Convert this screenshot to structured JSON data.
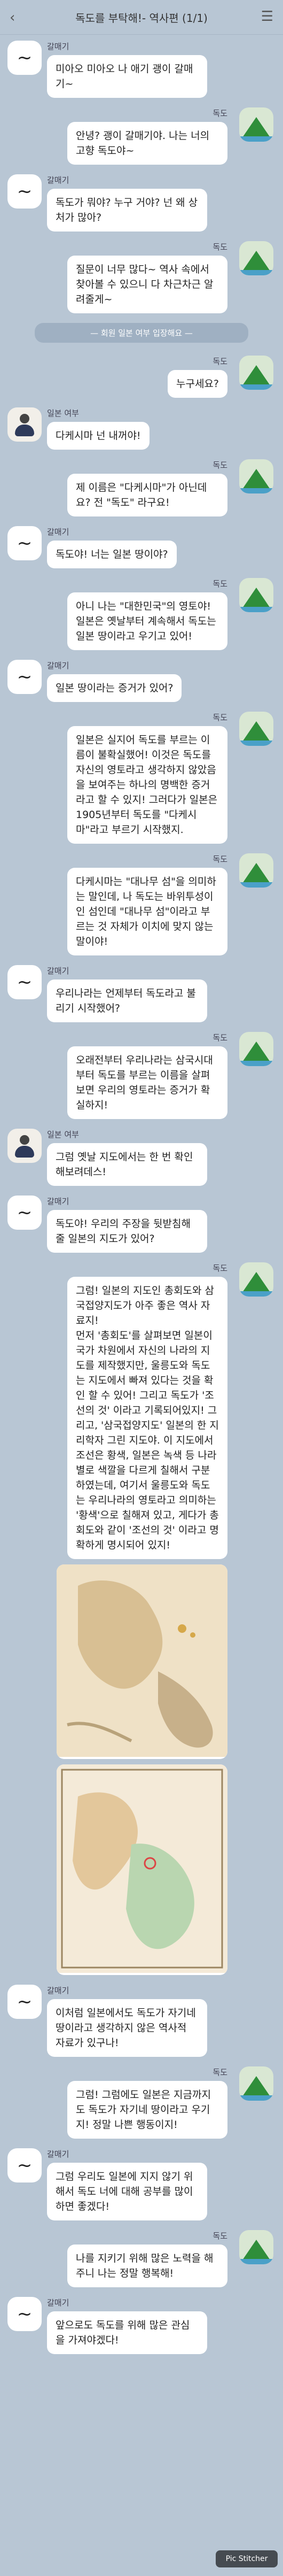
{
  "header": {
    "back_icon": "back-arrow-icon",
    "title": "독도를 부탁해!- 역사편 (1/1)",
    "menu_icon": "hamburger-menu-icon"
  },
  "system": {
    "joined": "— 회원 일본 여부 입장해요 —"
  },
  "messages": [
    {
      "side": "left",
      "sender": "갈매기",
      "text": "미아오 미아오 나 애기 괭이 갈매기~"
    },
    {
      "side": "right",
      "sender": "독도",
      "text": "안녕? 괭이 갈매기야. 나는 너의 고향 독도야~"
    },
    {
      "side": "left",
      "sender": "갈매기",
      "text": "독도가 뭐야? 누구 거야? 넌 왜 상처가 많아?"
    },
    {
      "side": "right",
      "sender": "독도",
      "text": "질문이 너무 많다~ 역사 속에서 찾아볼 수 있으니 다 차근차근 알려줄게~"
    },
    {
      "side": "right",
      "sender": "독도",
      "text": "누구세요?"
    },
    {
      "side": "left",
      "sender": "일본 여부",
      "text": "다케시마 넌 내꺼야!"
    },
    {
      "side": "right",
      "sender": "독도",
      "text": "제 이름은 \"다케시마\"가 아닌데요? 전 \"독도\" 라구요!"
    },
    {
      "side": "left",
      "sender": "갈매기",
      "text": "독도야! 너는 일본 땅이야?"
    },
    {
      "side": "right",
      "sender": "독도",
      "text": "아니 나는 \"대한민국\"의 영토야! 일본은 옛날부터 계속해서 독도는 일본 땅이라고 우기고 있어!"
    },
    {
      "side": "left",
      "sender": "갈매기",
      "text": "일본 땅이라는 증거가 있어?"
    },
    {
      "side": "right",
      "sender": "독도",
      "text": "일본은 실지어 독도를 부르는 이름이 불확실했어! 이것은 독도를 자신의 영토라고 생각하지 않았음을 보여주는 하나의 명백한 증거라고 할 수 있지! 그러다가 일본은 1905년부터 독도를 \"다케시마\"라고 부르기 시작했지."
    },
    {
      "side": "right",
      "sender": "독도",
      "text": "다케시마는 \"대나무 섬\"을 의미하는 말인데, 나 독도는 바위투성이인 섬인데 \"대나무 섬\"이라고 부르는 것 자체가 이치에 맞지 않는 말이야!"
    },
    {
      "side": "left",
      "sender": "갈매기",
      "text": "우리나라는 언제부터 독도라고 불리기 시작했어?"
    },
    {
      "side": "right",
      "sender": "독도",
      "text": "오래전부터 우리나라는 삼국시대부터 독도를 부르는 이름을 살펴보면 우리의 영토라는 증거가 확실하지!"
    },
    {
      "side": "left",
      "sender": "일본 여부",
      "text": "그럼 옛날 지도에서는 한 번 확인해보려데스!"
    },
    {
      "side": "left",
      "sender": "갈매기",
      "text": "독도야! 우리의 주장을 뒷받침해줄 일본의 지도가 있어?"
    },
    {
      "side": "right",
      "sender": "독도",
      "text": "그럼! 일본의 지도인 총회도와 삼국접양지도가 아주 좋은 역사 자료지!\n먼저 '총회도'를 살펴보면 일본이 국가 차원에서 자신의 나라의 지도를 제작했지만, 울릉도와 독도는 지도에서 빠져 있다는 것을 확인 할 수 있어! 그리고 독도가 '조선의 것' 이라고 기록되어있지! 그리고, '삼국접양지도' 일본의 한 지리학자 그린 지도야. 이 지도에서 조선은 황색, 일본은 녹색 등 나라별로 색깔을 다르게 칠해서 구분하였는데, 여기서 울릉도와 독도는 우리나라의 영토라고 의미하는 '황색'으로 칠해져 있고, 게다가 총회도와 같이 '조선의 것' 이라고 명확하게 명시되어 있지!"
    },
    {
      "side": "left",
      "sender": "갈매기",
      "text": "이처럼 일본에서도 독도가 자기네 땅이라고 생각하지 않은 역사적 자료가 있구나!"
    },
    {
      "side": "right",
      "sender": "독도",
      "text": "그럼! 그럼에도 일본은 지금까지도 독도가 자기네 땅이라고 우기지! 정말 나쁜 행동이지!"
    },
    {
      "side": "left",
      "sender": "갈매기",
      "text": "그럼 우리도 일본에 지지 않기 위해서 독도 너에 대해 공부를 많이 하면 좋겠다!"
    },
    {
      "side": "right",
      "sender": "독도",
      "text": "나를 지키기 위해 많은 노력을 해주니 나는 정말 행복해!"
    },
    {
      "side": "left",
      "sender": "갈매기",
      "text": "앞으로도 독도를 위해 많은 관심을 가져야겠다!"
    }
  ],
  "badge": "Pic Stitcher"
}
